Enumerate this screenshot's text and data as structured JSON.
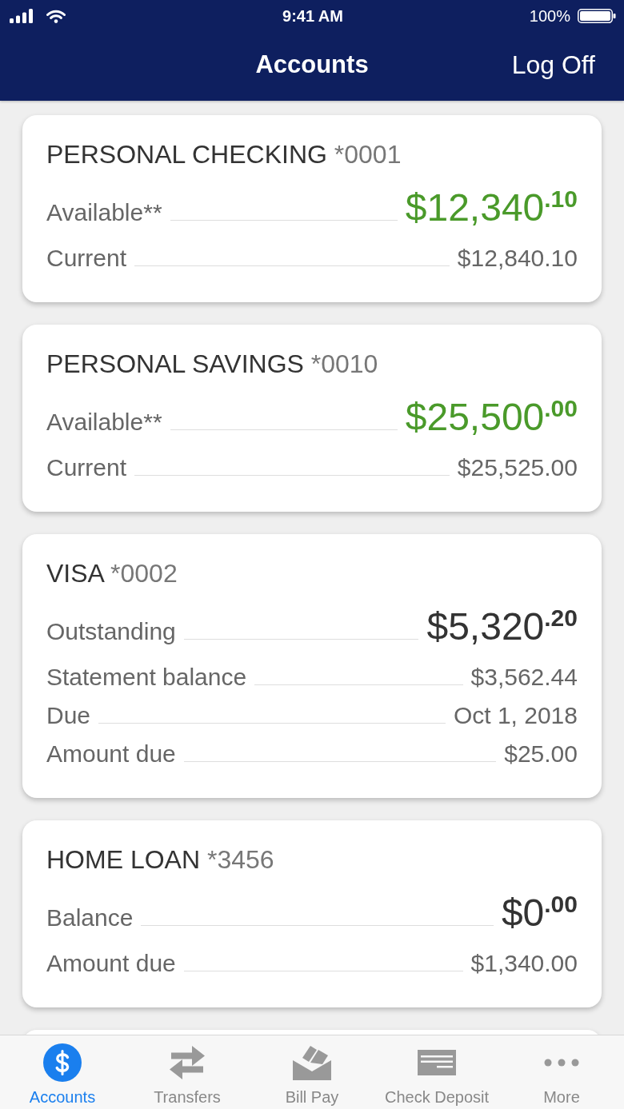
{
  "status_bar": {
    "time": "9:41 AM",
    "battery": "100%"
  },
  "header": {
    "title": "Accounts",
    "action": "Log Off"
  },
  "accounts": [
    {
      "name": "PERSONAL CHECKING",
      "number": "*0001",
      "rows": [
        {
          "kind": "primary",
          "label": "Available**",
          "value": "$12,340$^{.10}$",
          "color": "#4a9a2a"
        },
        {
          "kind": "secondary",
          "label": "Current",
          "value": "$12,840.10"
        }
      ]
    },
    {
      "name": "PERSONAL SAVINGS",
      "number": "*0010",
      "rows": [
        {
          "kind": "primary",
          "label": "Available**",
          "value": "$25,500$^{.00}$",
          "color": "#4a9a2a"
        },
        {
          "kind": "secondary",
          "label": "Current",
          "value": "$25,525.00"
        }
      ]
    },
    {
      "name": "VISA",
      "number": "*0002",
      "rows": [
        {
          "kind": "primary",
          "label": "Outstanding",
          "value": "$5,320$^{.20}$",
          "color": "#333333"
        },
        {
          "kind": "secondary",
          "label": "Statement balance",
          "value": "$3,562.44"
        },
        {
          "kind": "secondary",
          "label": "Due",
          "value": "Oct 1, 2018"
        },
        {
          "kind": "secondary",
          "label": "Amount due",
          "value": "$25.00"
        }
      ]
    },
    {
      "name": "HOME LOAN",
      "number": "*3456",
      "rows": [
        {
          "kind": "primary",
          "label": "Balance",
          "value": "$0$^{.00}$",
          "color": "#333333"
        },
        {
          "kind": "secondary",
          "label": "Amount due",
          "value": "$1,340.00"
        }
      ]
    }
  ],
  "list_continues": true,
  "tab_bar": [
    {
      "label": "Accounts",
      "selected": true
    },
    {
      "label": "Transfers",
      "selected": false
    },
    {
      "label": "Bill Pay",
      "selected": false
    },
    {
      "label": "Check Deposit",
      "selected": false
    },
    {
      "label": "More",
      "selected": false
    }
  ]
}
